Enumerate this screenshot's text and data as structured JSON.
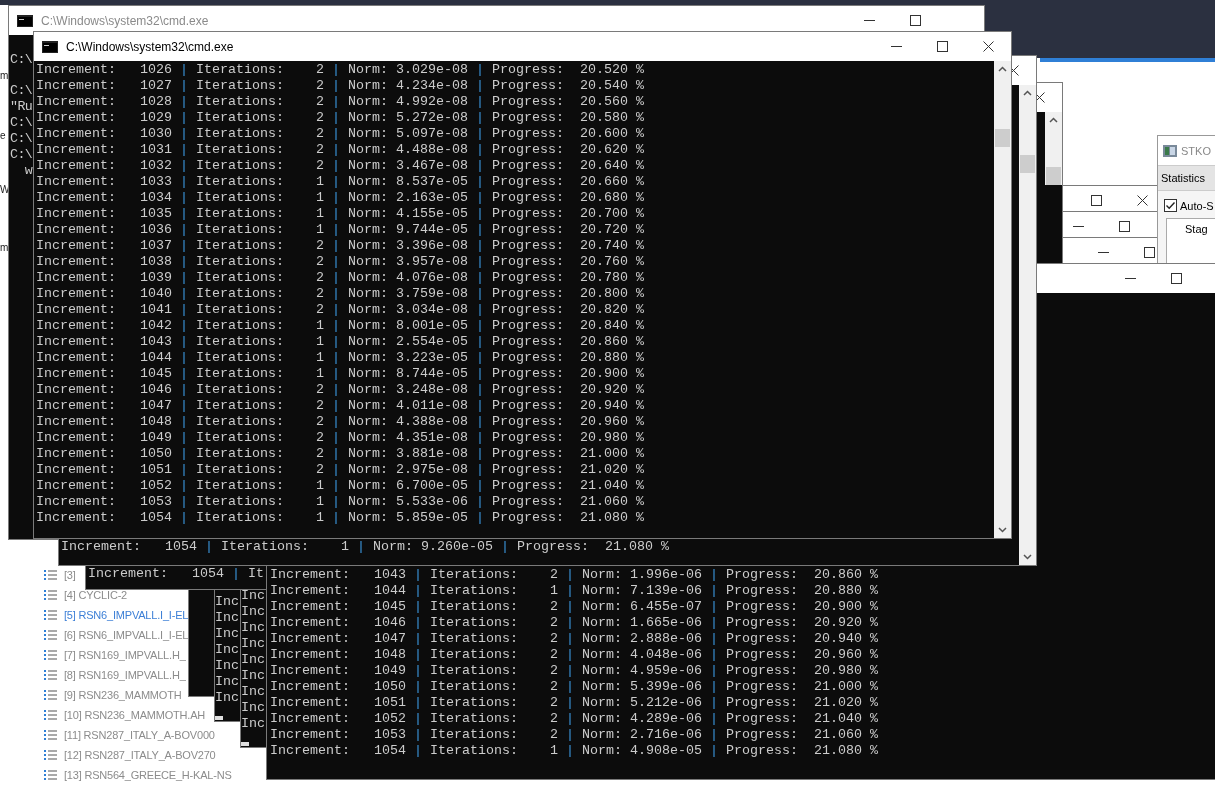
{
  "side_texts": [
    "m",
    "e",
    "W",
    "m"
  ],
  "sidebar": {
    "items": [
      {
        "label": "[3]",
        "selected": false
      },
      {
        "label": "[4] CYCLIC-2",
        "selected": false
      },
      {
        "label": "[5] RSN6_IMPVALL.I_I-EL",
        "selected": true
      },
      {
        "label": "[6] RSN6_IMPVALL.I_I-EL",
        "selected": false
      },
      {
        "label": "[7] RSN169_IMPVALL.H_",
        "selected": false
      },
      {
        "label": "[8] RSN169_IMPVALL.H_",
        "selected": false
      },
      {
        "label": "[9] RSN236_MAMMOTH",
        "selected": false
      },
      {
        "label": "[10] RSN236_MAMMOTH.AH",
        "selected": false
      },
      {
        "label": "[11] RSN287_ITALY_A-BOV000",
        "selected": false
      },
      {
        "label": "[12] RSN287_ITALY_A-BOV270",
        "selected": false
      },
      {
        "label": "[13] RSN564_GREECE_H-KAL-NS",
        "selected": false
      }
    ]
  },
  "windows": [
    {
      "kind": "console",
      "title": "C:\\Windows\\system32\\cmd.exe",
      "active": false,
      "lines": [
        "C:\\",
        "C:\\",
        "\"Ru",
        "C:\\",
        "C:\\",
        "C:\\",
        "  w"
      ]
    },
    {
      "kind": "console",
      "title": "C:\\Windows\\system32\\cmd.exe",
      "active": true,
      "lines": [
        "Increment:   1026 | Iterations:    2 | Norm: 3.029e-08 | Progress:  20.520 %",
        "Increment:   1027 | Iterations:    2 | Norm: 4.234e-08 | Progress:  20.540 %",
        "Increment:   1028 | Iterations:    2 | Norm: 4.992e-08 | Progress:  20.560 %",
        "Increment:   1029 | Iterations:    2 | Norm: 5.272e-08 | Progress:  20.580 %",
        "Increment:   1030 | Iterations:    2 | Norm: 5.097e-08 | Progress:  20.600 %",
        "Increment:   1031 | Iterations:    2 | Norm: 4.488e-08 | Progress:  20.620 %",
        "Increment:   1032 | Iterations:    2 | Norm: 3.467e-08 | Progress:  20.640 %",
        "Increment:   1033 | Iterations:    1 | Norm: 8.537e-05 | Progress:  20.660 %",
        "Increment:   1034 | Iterations:    1 | Norm: 2.163e-05 | Progress:  20.680 %",
        "Increment:   1035 | Iterations:    1 | Norm: 4.155e-05 | Progress:  20.700 %",
        "Increment:   1036 | Iterations:    1 | Norm: 9.744e-05 | Progress:  20.720 %",
        "Increment:   1037 | Iterations:    2 | Norm: 3.396e-08 | Progress:  20.740 %",
        "Increment:   1038 | Iterations:    2 | Norm: 3.957e-08 | Progress:  20.760 %",
        "Increment:   1039 | Iterations:    2 | Norm: 4.076e-08 | Progress:  20.780 %",
        "Increment:   1040 | Iterations:    2 | Norm: 3.759e-08 | Progress:  20.800 %",
        "Increment:   1041 | Iterations:    2 | Norm: 3.034e-08 | Progress:  20.820 %",
        "Increment:   1042 | Iterations:    1 | Norm: 8.001e-05 | Progress:  20.840 %",
        "Increment:   1043 | Iterations:    1 | Norm: 2.554e-05 | Progress:  20.860 %",
        "Increment:   1044 | Iterations:    1 | Norm: 3.223e-05 | Progress:  20.880 %",
        "Increment:   1045 | Iterations:    1 | Norm: 8.744e-05 | Progress:  20.900 %",
        "Increment:   1046 | Iterations:    2 | Norm: 3.248e-08 | Progress:  20.920 %",
        "Increment:   1047 | Iterations:    2 | Norm: 4.011e-08 | Progress:  20.940 %",
        "Increment:   1048 | Iterations:    2 | Norm: 4.388e-08 | Progress:  20.960 %",
        "Increment:   1049 | Iterations:    2 | Norm: 4.351e-08 | Progress:  20.980 %",
        "Increment:   1050 | Iterations:    2 | Norm: 3.881e-08 | Progress:  21.000 %",
        "Increment:   1051 | Iterations:    2 | Norm: 2.975e-08 | Progress:  21.020 %",
        "Increment:   1052 | Iterations:    1 | Norm: 6.700e-05 | Progress:  21.040 %",
        "Increment:   1053 | Iterations:    1 | Norm: 5.533e-06 | Progress:  21.060 %",
        "Increment:   1054 | Iterations:    1 | Norm: 5.859e-05 | Progress:  21.080 %"
      ]
    },
    {
      "kind": "console",
      "lines": [
        "Increment:   1054 | Iterations:    1 | Norm: 9.260e-05 | Progress:  21.080 %"
      ]
    },
    {
      "kind": "console",
      "lines": [
        "Increment:   1054 | It"
      ]
    },
    {
      "kind": "panel",
      "title": "STKO",
      "header": "Statistics",
      "checkbox": {
        "label": "Auto-S",
        "checked": true
      },
      "box_text": "Stag"
    },
    {
      "kind": "console"
    },
    {
      "kind": "console",
      "cursor": true,
      "lines": [
        "Inc",
        "Inc",
        "Inc",
        "Inc",
        "Inc",
        "Inc",
        "Inc"
      ]
    },
    {
      "kind": "console",
      "cursor": true,
      "lines": [
        "Inc",
        "Inc",
        "Inc",
        "Inc",
        "Inc",
        "Inc",
        "Inc",
        "Inc",
        "Inc"
      ]
    },
    {
      "kind": "console",
      "lines": [
        "Increment:   1043 | Iterations:    2 | Norm: 1.996e-06 | Progress:  20.860 %",
        "Increment:   1044 | Iterations:    1 | Norm: 7.139e-06 | Progress:  20.880 %",
        "Increment:   1045 | Iterations:    2 | Norm: 6.455e-07 | Progress:  20.900 %",
        "Increment:   1046 | Iterations:    2 | Norm: 1.665e-06 | Progress:  20.920 %",
        "Increment:   1047 | Iterations:    2 | Norm: 2.888e-06 | Progress:  20.940 %",
        "Increment:   1048 | Iterations:    2 | Norm: 4.048e-06 | Progress:  20.960 %",
        "Increment:   1049 | Iterations:    2 | Norm: 4.959e-06 | Progress:  20.980 %",
        "Increment:   1050 | Iterations:    2 | Norm: 5.399e-06 | Progress:  21.000 %",
        "Increment:   1051 | Iterations:    2 | Norm: 5.212e-06 | Progress:  21.020 %",
        "Increment:   1052 | Iterations:    2 | Norm: 4.289e-06 | Progress:  21.040 %",
        "Increment:   1053 | Iterations:    2 | Norm: 2.716e-06 | Progress:  21.060 %",
        "Increment:   1054 | Iterations:    1 | Norm: 4.908e-05 | Progress:  21.080 %"
      ]
    }
  ]
}
